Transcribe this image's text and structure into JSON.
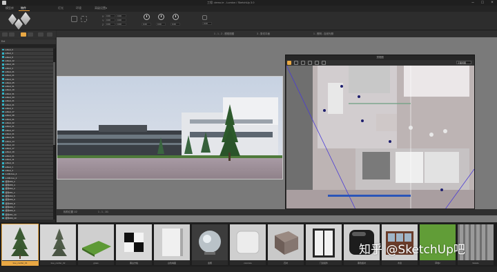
{
  "window": {
    "title": "工程: demo.ie - Lumion / SketchUp 3.0"
  },
  "menu": {
    "items": [
      {
        "label": "模型库"
      },
      {
        "label": "物件"
      },
      {
        "label": "灯光"
      },
      {
        "label": "环境"
      },
      {
        "label": "高级设置"
      }
    ],
    "active_index": 1
  },
  "toolbar": {
    "field_values": [
      "0.00",
      "0.00",
      "0.00",
      "0.00",
      "0.00",
      "0.00"
    ],
    "dial_values": [
      "0.00",
      "0.00",
      "0.00"
    ],
    "extra_value": "0.00"
  },
  "leftpanel": {
    "header": "Ent",
    "rows": [
      "edited_0",
      "edited_4",
      "edited_8",
      "edited_12",
      "edited_16",
      "edited_2",
      "edited_21",
      "edited_21",
      "edited_21",
      "edited_25",
      "edited_31",
      "edited_19",
      "edited_31",
      "edited_33",
      "edited_21",
      "edited_21",
      "edited_3",
      "edited_17",
      "edited_38",
      "edited_21",
      "edited_42",
      "edited_21",
      "edited_47",
      "edited_21",
      "edited_61",
      "edited_14",
      "edited_13",
      "edited_17",
      "edited_19",
      "edited_21",
      "edited_11",
      "edited_11",
      "edited_1",
      "edited_3",
      "1-006-box_4",
      "1-006-box_2",
      "组件#06_2",
      "组件#06_4",
      "组件#02_2",
      "组件#01_1",
      "组件#03_5",
      "组件#06_6",
      "组件#06_8",
      "组件#06_7",
      "组件#06_9",
      "组件#01_14",
      "组件#06_10",
      "组件#02_11",
      "组件#4.1_3",
      "组件#4.1_11"
    ]
  },
  "viewport": {
    "header_labels": [
      "1 - 1 - 2 - 透视视图",
      "3 - 剪切平面",
      "1 - 照明 - 自然光照"
    ],
    "footer_labels": [
      "相机位置 1/2",
      "1 - 1 - 1/1"
    ]
  },
  "planwindow": {
    "title": "顶视图",
    "view_option": "平面视图"
  },
  "materials": [
    {
      "label": "tree_conifer_01",
      "selected": true
    },
    {
      "label": "tree_conifer_02",
      "selected": false
    },
    {
      "label": "grass",
      "selected": false
    },
    {
      "label": "黑白方格",
      "selected": false
    },
    {
      "label": "白色墙面",
      "selected": false
    },
    {
      "label": "金属",
      "selected": false
    },
    {
      "label": "concrete",
      "selected": false
    },
    {
      "label": "石材",
      "selected": false
    },
    {
      "label": "门窗组件",
      "selected": false
    },
    {
      "label": "黑色板材",
      "selected": false
    },
    {
      "label": "木窗",
      "selected": false
    },
    {
      "label": "草地2",
      "selected": false
    },
    {
      "label": "facade",
      "selected": false
    }
  ],
  "watermark": "知乎 @SketchUp吧",
  "colors": {
    "accent": "#e9a844",
    "list_dot": "#2fb6c9"
  }
}
